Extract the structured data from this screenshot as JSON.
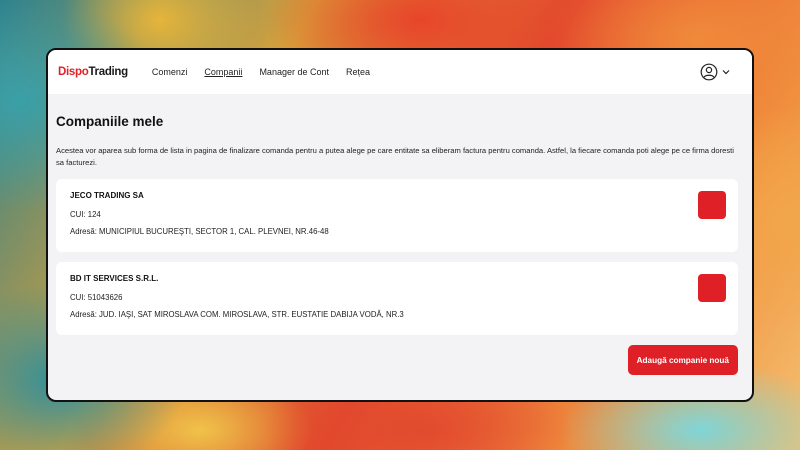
{
  "brand": {
    "part1": "Dispo",
    "part2": "Trading",
    "accent": "#e02027"
  },
  "nav": {
    "items": [
      {
        "label": "Comenzi"
      },
      {
        "label": "Companii"
      },
      {
        "label": "Manager de Cont"
      },
      {
        "label": "Rețea"
      }
    ],
    "active": "Companii"
  },
  "account": {
    "icon": "user-circle-icon",
    "chevron": "chevron-down-icon"
  },
  "page": {
    "title": "Companiile mele",
    "description": "Acestea vor aparea sub forma de lista in pagina de finalizare comanda pentru a putea alege pe care entitate sa eliberam factura pentru comanda. Astfel, la fiecare comanda poti alege pe ce firma doresti sa facturezi."
  },
  "companies": [
    {
      "name": "JECO TRADING SA",
      "cui": "CUI: 124",
      "address": "Adresă: MUNICIPIUL BUCUREŞTI, SECTOR 1, CAL. PLEVNEI, NR.46-48"
    },
    {
      "name": "BD IT SERVICES S.R.L.",
      "cui": "CUI: 51043626",
      "address": "Adresă: JUD. IAŞI, SAT MIROSLAVA COM. MIROSLAVA, STR. EUSTATIE DABIJA VODĂ, NR.3"
    }
  ],
  "actions": {
    "add_company": "Adaugă companie nouă"
  }
}
